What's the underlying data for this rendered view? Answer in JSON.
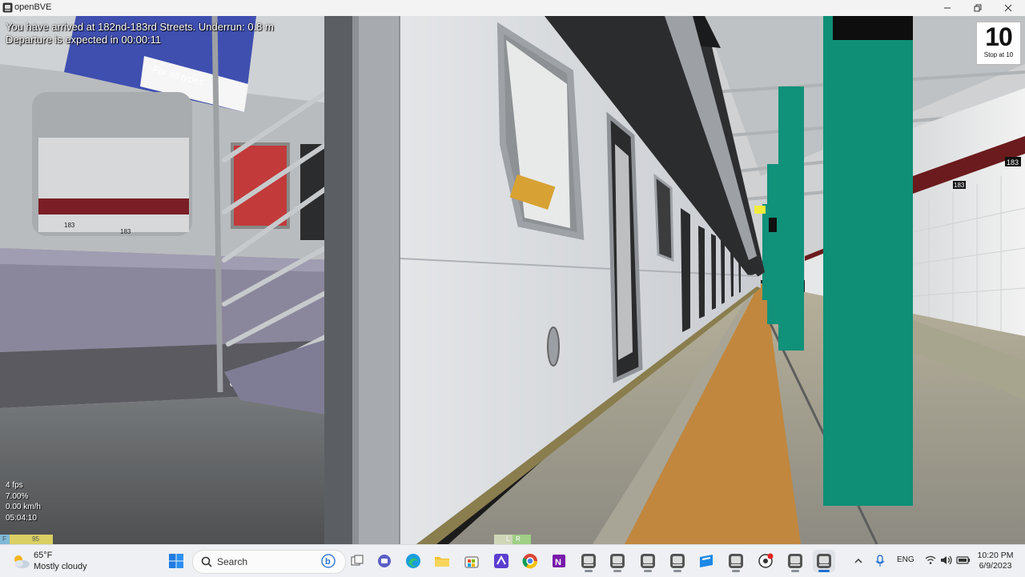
{
  "window": {
    "title": "openBVE"
  },
  "hud": {
    "message_1": "You have arrived at 182nd-183rd Streets. Underrun: 0.8 m",
    "message_2": "Departure is expected in 00:00:11",
    "stop_number": "10",
    "stop_caption": "Stop at 10"
  },
  "stats": {
    "fps": "4 fps",
    "percent": "7.00%",
    "speed": "0.00 km/h",
    "time": "05:04:10"
  },
  "indicators": {
    "left_a": "F",
    "left_b": "95",
    "right_a": "L",
    "right_b": "R"
  },
  "scene_signs": {
    "station_number_a": "183",
    "station_number_b": "183",
    "window_number_a": "183",
    "window_number_b": "183",
    "ad_text": "For all types"
  },
  "taskbar": {
    "weather_temp": "65°F",
    "weather_desc": "Mostly cloudy",
    "search_placeholder": "Search",
    "language": "ENG",
    "time": "10:20 PM",
    "date": "6/9/2023"
  },
  "colors": {
    "pillar": "#0f8f76",
    "platform_stripe": "#c1873e",
    "train_body": "#dcdfe2",
    "taskbar": "#eef0f3"
  }
}
